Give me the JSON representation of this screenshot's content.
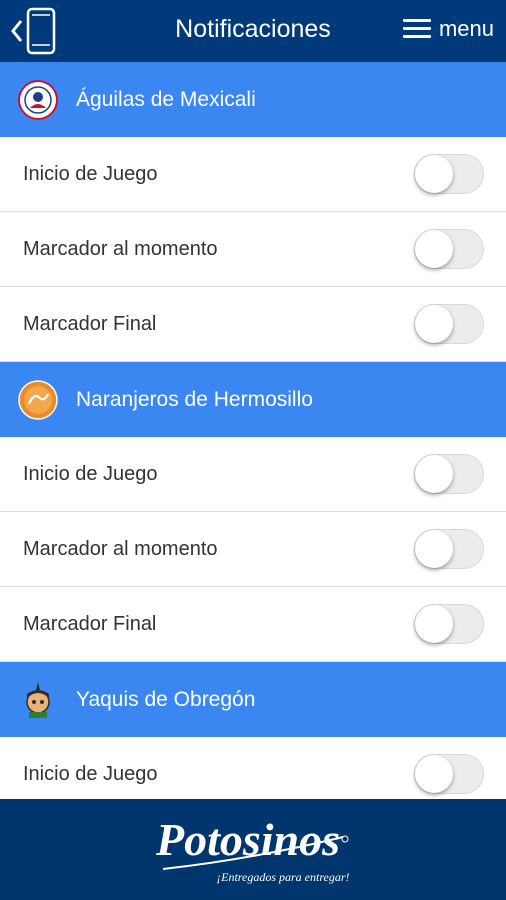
{
  "header": {
    "title": "Notificaciones",
    "menu_label": "menu"
  },
  "teams": [
    {
      "name": "Águilas de Mexicali",
      "toggles": [
        {
          "label": "Inicio de Juego",
          "on": false
        },
        {
          "label": "Marcador al momento",
          "on": false
        },
        {
          "label": "Marcador Final",
          "on": false
        }
      ]
    },
    {
      "name": "Naranjeros de Hermosillo",
      "toggles": [
        {
          "label": "Inicio de Juego",
          "on": false
        },
        {
          "label": "Marcador al momento",
          "on": false
        },
        {
          "label": "Marcador Final",
          "on": false
        }
      ]
    },
    {
      "name": "Yaquis de Obregón",
      "toggles": [
        {
          "label": "Inicio de Juego",
          "on": false
        }
      ]
    }
  ],
  "footer": {
    "brand": "Potosinos",
    "tagline": "¡Entregados para entregar!"
  },
  "colors": {
    "header_bg": "#003a7a",
    "section_bg": "#3b87f2",
    "footer_bg": "#00356e"
  }
}
